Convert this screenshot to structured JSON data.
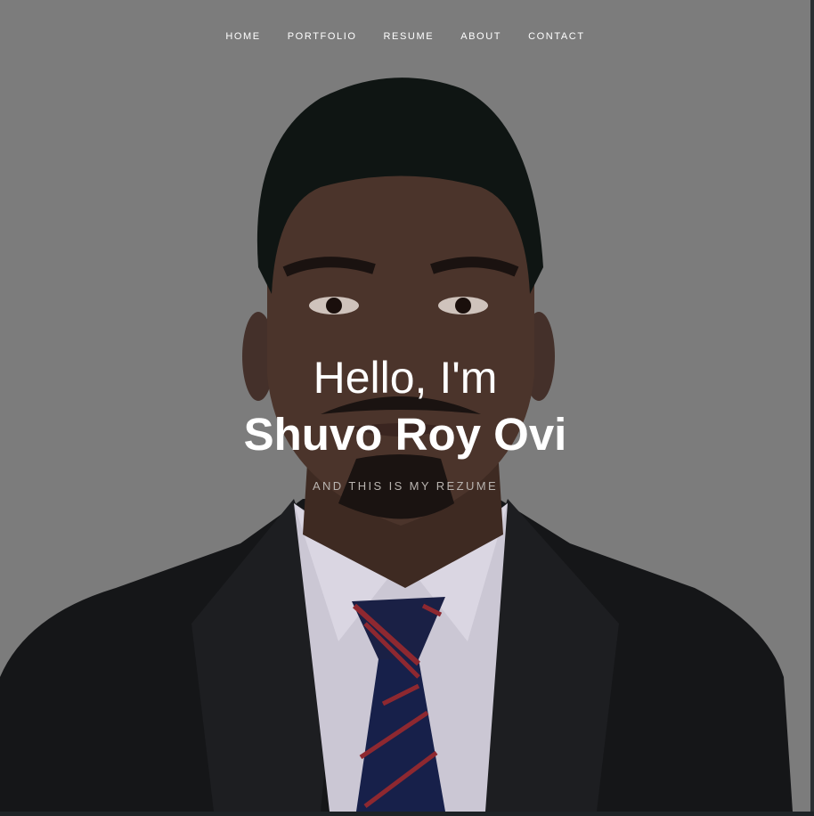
{
  "nav": {
    "items": [
      "HOME",
      "PORTFOLIO",
      "RESUME",
      "ABOUT",
      "CONTACT"
    ]
  },
  "hero": {
    "greeting": "Hello, I'm",
    "name": "Shuvo Roy Ovi",
    "tagline": "AND THIS IS MY REZUME"
  },
  "colors": {
    "overlay": "#7c7c7c",
    "text": "#ffffff",
    "tagline": "#b9b4b0",
    "page_background": "#1e2326"
  },
  "images": {
    "portrait": "portrait-photo"
  }
}
